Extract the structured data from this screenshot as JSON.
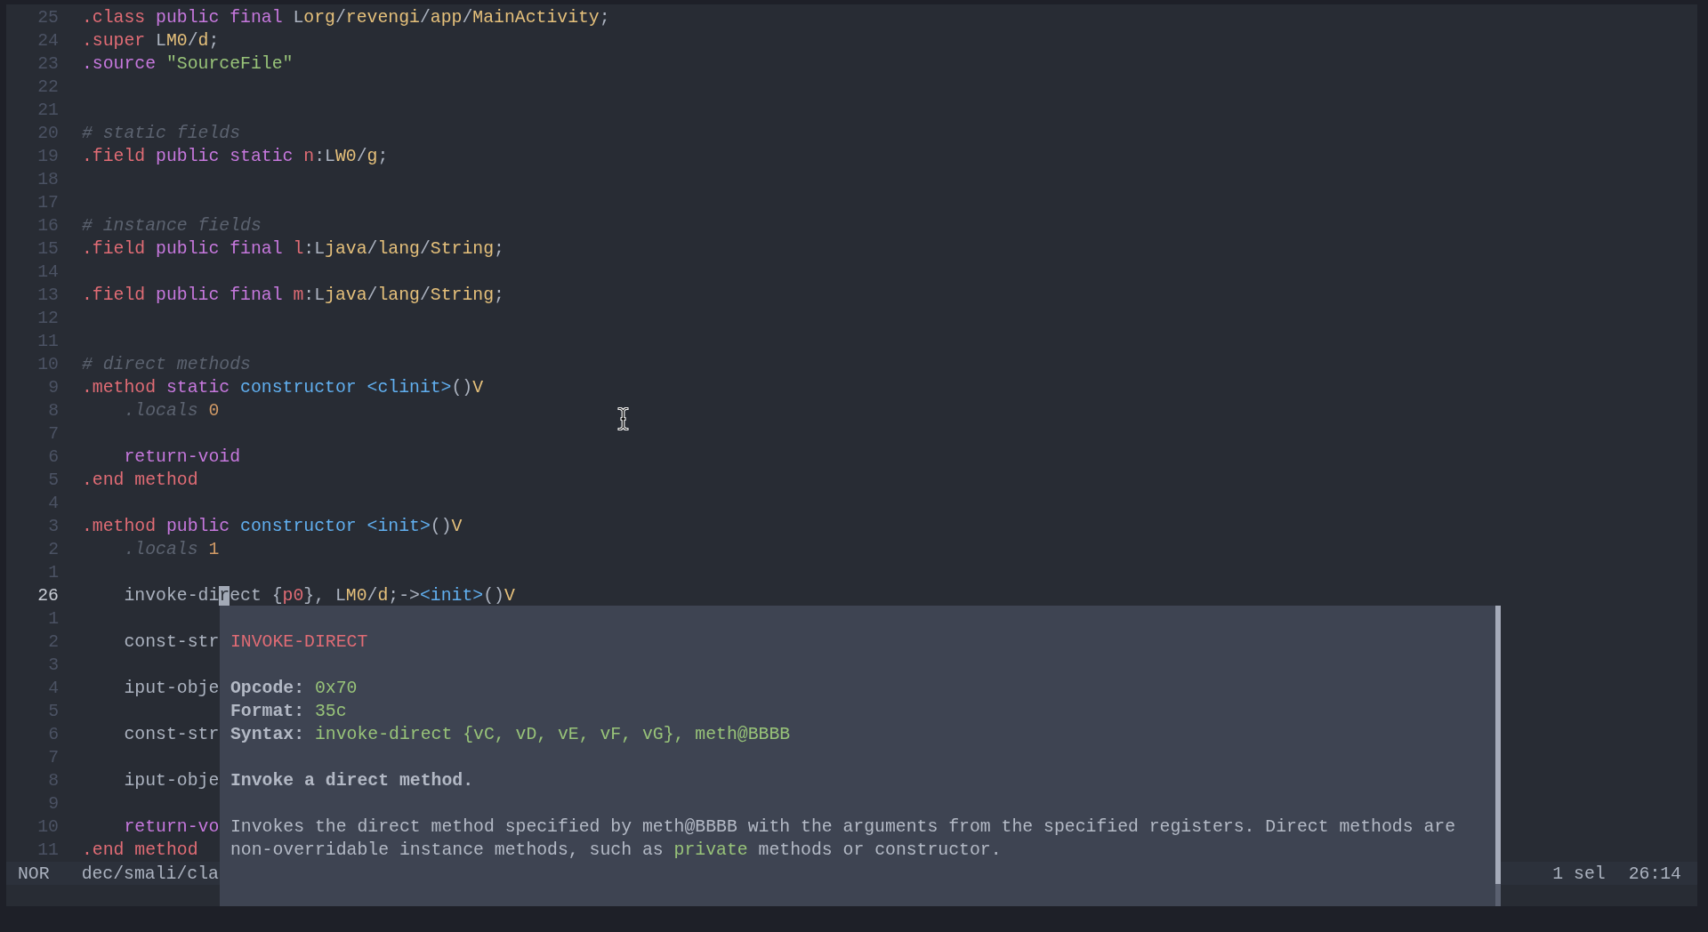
{
  "editor": {
    "lines": [
      {
        "number": "25",
        "current": false,
        "tokens": [
          {
            "kind": "directive",
            "text": ".class"
          },
          {
            "kind": "keyword",
            "text": " public final "
          },
          {
            "kind": "plain",
            "text": "L"
          },
          {
            "kind": "type",
            "text": "org"
          },
          {
            "kind": "plain",
            "text": "/"
          },
          {
            "kind": "type",
            "text": "revengi"
          },
          {
            "kind": "plain",
            "text": "/"
          },
          {
            "kind": "type",
            "text": "app"
          },
          {
            "kind": "plain",
            "text": "/"
          },
          {
            "kind": "type",
            "text": "MainActivity"
          },
          {
            "kind": "plain",
            "text": ";"
          }
        ]
      },
      {
        "number": "24",
        "current": false,
        "tokens": [
          {
            "kind": "directive",
            "text": ".super"
          },
          {
            "kind": "plain",
            "text": " L"
          },
          {
            "kind": "type",
            "text": "M0"
          },
          {
            "kind": "plain",
            "text": "/"
          },
          {
            "kind": "type",
            "text": "d"
          },
          {
            "kind": "plain",
            "text": ";"
          }
        ]
      },
      {
        "number": "23",
        "current": false,
        "tokens": [
          {
            "kind": "keyword",
            "text": ".source "
          },
          {
            "kind": "string",
            "text": "\"SourceFile\""
          }
        ]
      },
      {
        "number": "22",
        "current": false
      },
      {
        "number": "21",
        "current": false
      },
      {
        "number": "20",
        "current": false,
        "tokens": [
          {
            "kind": "comment",
            "text": "# static fields"
          }
        ]
      },
      {
        "number": "19",
        "current": false,
        "tokens": [
          {
            "kind": "directive",
            "text": ".field"
          },
          {
            "kind": "keyword",
            "text": " public static "
          },
          {
            "kind": "variable",
            "text": "n"
          },
          {
            "kind": "plain",
            "text": ":L"
          },
          {
            "kind": "type",
            "text": "W0"
          },
          {
            "kind": "plain",
            "text": "/"
          },
          {
            "kind": "type",
            "text": "g"
          },
          {
            "kind": "plain",
            "text": ";"
          }
        ]
      },
      {
        "number": "18",
        "current": false
      },
      {
        "number": "17",
        "current": false
      },
      {
        "number": "16",
        "current": false,
        "tokens": [
          {
            "kind": "comment",
            "text": "# instance fields"
          }
        ]
      },
      {
        "number": "15",
        "current": false,
        "tokens": [
          {
            "kind": "directive",
            "text": ".field"
          },
          {
            "kind": "keyword",
            "text": " public final "
          },
          {
            "kind": "variable",
            "text": "l"
          },
          {
            "kind": "plain",
            "text": ":L"
          },
          {
            "kind": "type",
            "text": "java"
          },
          {
            "kind": "plain",
            "text": "/"
          },
          {
            "kind": "type",
            "text": "lang"
          },
          {
            "kind": "plain",
            "text": "/"
          },
          {
            "kind": "type",
            "text": "String"
          },
          {
            "kind": "plain",
            "text": ";"
          }
        ]
      },
      {
        "number": "14",
        "current": false
      },
      {
        "number": "13",
        "current": false,
        "tokens": [
          {
            "kind": "directive",
            "text": ".field"
          },
          {
            "kind": "keyword",
            "text": " public final "
          },
          {
            "kind": "variable",
            "text": "m"
          },
          {
            "kind": "plain",
            "text": ":L"
          },
          {
            "kind": "type",
            "text": "java"
          },
          {
            "kind": "plain",
            "text": "/"
          },
          {
            "kind": "type",
            "text": "lang"
          },
          {
            "kind": "plain",
            "text": "/"
          },
          {
            "kind": "type",
            "text": "String"
          },
          {
            "kind": "plain",
            "text": ";"
          }
        ]
      },
      {
        "number": "12",
        "current": false
      },
      {
        "number": "11",
        "current": false
      },
      {
        "number": "10",
        "current": false,
        "tokens": [
          {
            "kind": "comment",
            "text": "# direct methods"
          }
        ]
      },
      {
        "number": "9",
        "current": false,
        "tokens": [
          {
            "kind": "directive",
            "text": ".method"
          },
          {
            "kind": "keyword",
            "text": " static "
          },
          {
            "kind": "function",
            "text": "constructor <clinit>"
          },
          {
            "kind": "plain",
            "text": "()"
          },
          {
            "kind": "type",
            "text": "V"
          }
        ],
        "children": [
          {
            "number": "8",
            "current": false,
            "tokens": [
              {
                "kind": "comment",
                "text": ".locals"
              },
              {
                "kind": "number",
                "text": " 0"
              }
            ]
          },
          {
            "number": "7",
            "current": false
          },
          {
            "number": "6",
            "current": false,
            "tokens": [
              {
                "kind": "keyword",
                "text": "return-void"
              }
            ]
          }
        ]
      },
      {
        "number": "5",
        "current": false,
        "tokens": [
          {
            "kind": "directive",
            "text": ".end method"
          }
        ]
      },
      {
        "number": "4",
        "current": false
      },
      {
        "number": "3",
        "current": false,
        "tokens": [
          {
            "kind": "directive",
            "text": ".method"
          },
          {
            "kind": "keyword",
            "text": " public "
          },
          {
            "kind": "function",
            "text": "constructor <init>"
          },
          {
            "kind": "plain",
            "text": "()"
          },
          {
            "kind": "type",
            "text": "V"
          }
        ],
        "children": [
          {
            "number": "2",
            "current": false,
            "tokens": [
              {
                "kind": "comment",
                "text": ".locals"
              },
              {
                "kind": "number",
                "text": " 1"
              }
            ]
          },
          {
            "number": "1",
            "current": false
          },
          {
            "number": "26",
            "current": true,
            "tokens": [
              {
                "kind": "plain",
                "text": "invoke-di"
              },
              {
                "kind": "cursor",
                "text": "r"
              },
              {
                "kind": "plain",
                "text": "ect {"
              },
              {
                "kind": "variable",
                "text": "p0"
              },
              {
                "kind": "plain",
                "text": "}, L"
              },
              {
                "kind": "type",
                "text": "M0"
              },
              {
                "kind": "plain",
                "text": "/"
              },
              {
                "kind": "type",
                "text": "d"
              },
              {
                "kind": "plain",
                "text": ";->"
              },
              {
                "kind": "function",
                "text": "<init>"
              },
              {
                "kind": "plain",
                "text": "()"
              },
              {
                "kind": "type",
                "text": "V"
              }
            ]
          },
          {
            "number": "1",
            "current": false
          },
          {
            "number": "2",
            "current": false,
            "tokens": [
              {
                "kind": "plain",
                "text": "const-str"
              }
            ]
          },
          {
            "number": "3",
            "current": false
          },
          {
            "number": "4",
            "current": false,
            "tokens": [
              {
                "kind": "plain",
                "text": "iput-obje"
              }
            ]
          },
          {
            "number": "5",
            "current": false
          },
          {
            "number": "6",
            "current": false,
            "tokens": [
              {
                "kind": "plain",
                "text": "const-str"
              }
            ]
          },
          {
            "number": "7",
            "current": false
          },
          {
            "number": "8",
            "current": false,
            "tokens": [
              {
                "kind": "plain",
                "text": "iput-obje"
              }
            ]
          },
          {
            "number": "9",
            "current": false
          },
          {
            "number": "10",
            "current": false,
            "tokens": [
              {
                "kind": "keyword",
                "text": "return-vo"
              }
            ]
          }
        ]
      },
      {
        "number": "11",
        "current": false,
        "tokens": [
          {
            "kind": "directive",
            "text": ".end method"
          }
        ]
      }
    ]
  },
  "popup": {
    "title": "INVOKE-DIRECT",
    "fields": [
      {
        "label": "Opcode:",
        "value": "0x70"
      },
      {
        "label": "Format:",
        "value": "35c"
      },
      {
        "label": "Syntax:",
        "value": "invoke-direct {vC, vD, vE, vF, vG}, meth@BBBB"
      }
    ],
    "summary": "Invoke a direct method.",
    "description": [
      {
        "kind": "text",
        "text": "Invokes the direct method specified by meth@BBBB with the arguments from the specified registers. Direct methods are non-overridable instance methods, such as "
      },
      {
        "kind": "code",
        "text": "private"
      },
      {
        "kind": "text",
        "text": " methods or constructor."
      }
    ]
  },
  "status_bar": {
    "mode": "NOR",
    "file_path": "dec/smali/cla",
    "selections": "1 sel",
    "position": "26:14"
  }
}
